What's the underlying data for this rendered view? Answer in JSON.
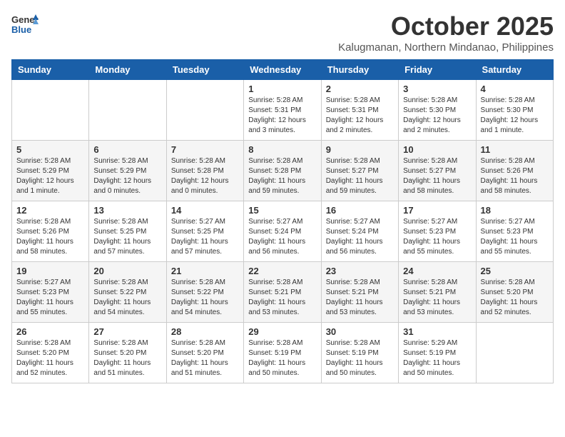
{
  "header": {
    "logo_general": "General",
    "logo_blue": "Blue",
    "month": "October 2025",
    "location": "Kalugmanan, Northern Mindanao, Philippines"
  },
  "weekdays": [
    "Sunday",
    "Monday",
    "Tuesday",
    "Wednesday",
    "Thursday",
    "Friday",
    "Saturday"
  ],
  "weeks": [
    [
      {
        "day": "",
        "info": ""
      },
      {
        "day": "",
        "info": ""
      },
      {
        "day": "",
        "info": ""
      },
      {
        "day": "1",
        "info": "Sunrise: 5:28 AM\nSunset: 5:31 PM\nDaylight: 12 hours\nand 3 minutes."
      },
      {
        "day": "2",
        "info": "Sunrise: 5:28 AM\nSunset: 5:31 PM\nDaylight: 12 hours\nand 2 minutes."
      },
      {
        "day": "3",
        "info": "Sunrise: 5:28 AM\nSunset: 5:30 PM\nDaylight: 12 hours\nand 2 minutes."
      },
      {
        "day": "4",
        "info": "Sunrise: 5:28 AM\nSunset: 5:30 PM\nDaylight: 12 hours\nand 1 minute."
      }
    ],
    [
      {
        "day": "5",
        "info": "Sunrise: 5:28 AM\nSunset: 5:29 PM\nDaylight: 12 hours\nand 1 minute."
      },
      {
        "day": "6",
        "info": "Sunrise: 5:28 AM\nSunset: 5:29 PM\nDaylight: 12 hours\nand 0 minutes."
      },
      {
        "day": "7",
        "info": "Sunrise: 5:28 AM\nSunset: 5:28 PM\nDaylight: 12 hours\nand 0 minutes."
      },
      {
        "day": "8",
        "info": "Sunrise: 5:28 AM\nSunset: 5:28 PM\nDaylight: 11 hours\nand 59 minutes."
      },
      {
        "day": "9",
        "info": "Sunrise: 5:28 AM\nSunset: 5:27 PM\nDaylight: 11 hours\nand 59 minutes."
      },
      {
        "day": "10",
        "info": "Sunrise: 5:28 AM\nSunset: 5:27 PM\nDaylight: 11 hours\nand 58 minutes."
      },
      {
        "day": "11",
        "info": "Sunrise: 5:28 AM\nSunset: 5:26 PM\nDaylight: 11 hours\nand 58 minutes."
      }
    ],
    [
      {
        "day": "12",
        "info": "Sunrise: 5:28 AM\nSunset: 5:26 PM\nDaylight: 11 hours\nand 58 minutes."
      },
      {
        "day": "13",
        "info": "Sunrise: 5:28 AM\nSunset: 5:25 PM\nDaylight: 11 hours\nand 57 minutes."
      },
      {
        "day": "14",
        "info": "Sunrise: 5:27 AM\nSunset: 5:25 PM\nDaylight: 11 hours\nand 57 minutes."
      },
      {
        "day": "15",
        "info": "Sunrise: 5:27 AM\nSunset: 5:24 PM\nDaylight: 11 hours\nand 56 minutes."
      },
      {
        "day": "16",
        "info": "Sunrise: 5:27 AM\nSunset: 5:24 PM\nDaylight: 11 hours\nand 56 minutes."
      },
      {
        "day": "17",
        "info": "Sunrise: 5:27 AM\nSunset: 5:23 PM\nDaylight: 11 hours\nand 55 minutes."
      },
      {
        "day": "18",
        "info": "Sunrise: 5:27 AM\nSunset: 5:23 PM\nDaylight: 11 hours\nand 55 minutes."
      }
    ],
    [
      {
        "day": "19",
        "info": "Sunrise: 5:27 AM\nSunset: 5:23 PM\nDaylight: 11 hours\nand 55 minutes."
      },
      {
        "day": "20",
        "info": "Sunrise: 5:28 AM\nSunset: 5:22 PM\nDaylight: 11 hours\nand 54 minutes."
      },
      {
        "day": "21",
        "info": "Sunrise: 5:28 AM\nSunset: 5:22 PM\nDaylight: 11 hours\nand 54 minutes."
      },
      {
        "day": "22",
        "info": "Sunrise: 5:28 AM\nSunset: 5:21 PM\nDaylight: 11 hours\nand 53 minutes."
      },
      {
        "day": "23",
        "info": "Sunrise: 5:28 AM\nSunset: 5:21 PM\nDaylight: 11 hours\nand 53 minutes."
      },
      {
        "day": "24",
        "info": "Sunrise: 5:28 AM\nSunset: 5:21 PM\nDaylight: 11 hours\nand 53 minutes."
      },
      {
        "day": "25",
        "info": "Sunrise: 5:28 AM\nSunset: 5:20 PM\nDaylight: 11 hours\nand 52 minutes."
      }
    ],
    [
      {
        "day": "26",
        "info": "Sunrise: 5:28 AM\nSunset: 5:20 PM\nDaylight: 11 hours\nand 52 minutes."
      },
      {
        "day": "27",
        "info": "Sunrise: 5:28 AM\nSunset: 5:20 PM\nDaylight: 11 hours\nand 51 minutes."
      },
      {
        "day": "28",
        "info": "Sunrise: 5:28 AM\nSunset: 5:20 PM\nDaylight: 11 hours\nand 51 minutes."
      },
      {
        "day": "29",
        "info": "Sunrise: 5:28 AM\nSunset: 5:19 PM\nDaylight: 11 hours\nand 50 minutes."
      },
      {
        "day": "30",
        "info": "Sunrise: 5:28 AM\nSunset: 5:19 PM\nDaylight: 11 hours\nand 50 minutes."
      },
      {
        "day": "31",
        "info": "Sunrise: 5:29 AM\nSunset: 5:19 PM\nDaylight: 11 hours\nand 50 minutes."
      },
      {
        "day": "",
        "info": ""
      }
    ]
  ]
}
